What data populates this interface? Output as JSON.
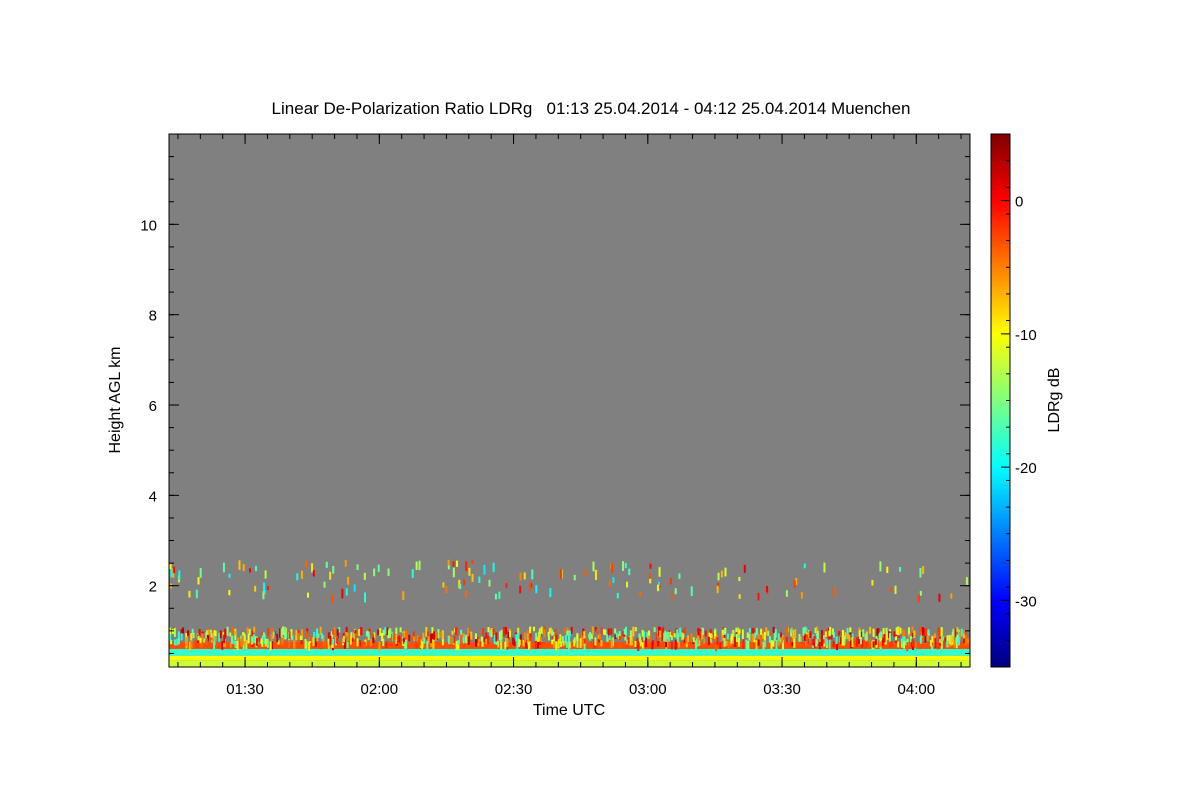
{
  "chart_data": {
    "type": "heatmap",
    "title": "Linear De-Polarization Ratio LDRg   01:13 25.04.2014 - 04:12 25.04.2014 Muenchen",
    "xlabel": "Time UTC",
    "ylabel": "Height AGL km",
    "xlim": [
      "01:13",
      "04:12"
    ],
    "ylim": [
      0.2,
      12.0
    ],
    "x_ticks": [
      {
        "value": "01:30",
        "label": "01:30"
      },
      {
        "value": "02:00",
        "label": "02:00"
      },
      {
        "value": "02:30",
        "label": "02:30"
      },
      {
        "value": "03:00",
        "label": "03:00"
      },
      {
        "value": "03:30",
        "label": "03:30"
      },
      {
        "value": "04:00",
        "label": "04:00"
      }
    ],
    "y_ticks": [
      {
        "value": 2,
        "label": "2"
      },
      {
        "value": 4,
        "label": "4"
      },
      {
        "value": 6,
        "label": "6"
      },
      {
        "value": 8,
        "label": "8"
      },
      {
        "value": 10,
        "label": "10"
      }
    ],
    "background_color": "#808080",
    "colorbar": {
      "label": "LDRg dB",
      "range": [
        -35,
        5
      ],
      "ticks": [
        {
          "value": 0,
          "label": "0"
        },
        {
          "value": -10,
          "label": "-10"
        },
        {
          "value": -20,
          "label": "-20"
        },
        {
          "value": -30,
          "label": "-30"
        }
      ],
      "colormap": "jet",
      "colors": [
        "#00007f",
        "#0000ff",
        "#007fff",
        "#00ffff",
        "#7fff7f",
        "#ffff00",
        "#ff7f00",
        "#ff0000",
        "#7f0000"
      ]
    },
    "layers": [
      {
        "height_km": [
          0.2,
          0.35
        ],
        "ldr_db": -12
      },
      {
        "height_km": [
          0.35,
          0.45
        ],
        "ldr_db": -10
      },
      {
        "height_km": [
          0.45,
          0.6
        ],
        "ldr_db": -18
      },
      {
        "height_km": [
          0.6,
          0.75
        ],
        "ldr_db": -3
      },
      {
        "height_km": [
          0.75,
          1.1
        ],
        "ldr_db": -8,
        "sparse": true
      },
      {
        "height_km": [
          1.8,
          2.6
        ],
        "ldr_db": -10,
        "sparse": true
      }
    ],
    "grid": false,
    "legend": "none"
  }
}
